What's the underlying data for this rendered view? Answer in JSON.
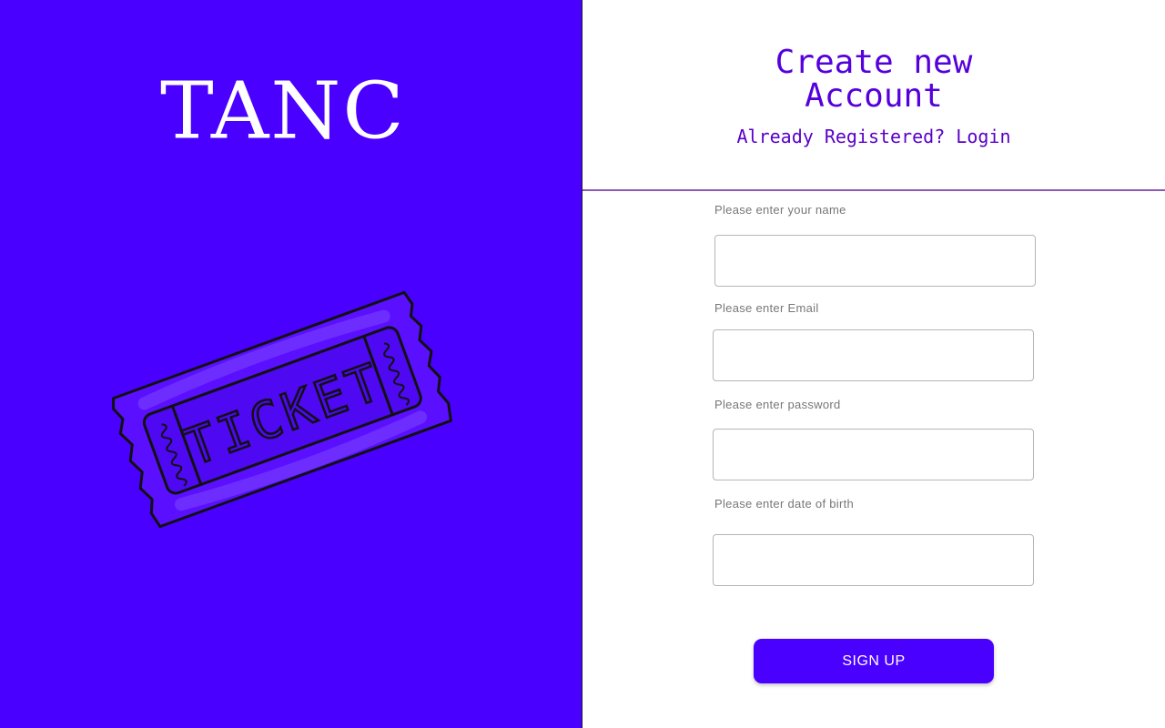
{
  "brand": {
    "name": "TANC"
  },
  "illustration": {
    "text": "TICKET",
    "icon": "ticket-icon"
  },
  "header": {
    "title": "Create new\nAccount",
    "login_link": "Already Registered? Login"
  },
  "form": {
    "name_label": "Please enter your name",
    "name_value": "",
    "email_label": "Please enter Email",
    "email_value": "",
    "password_label": "Please enter password",
    "password_value": "",
    "dob_label": "Please enter date of birth",
    "dob_value": "",
    "submit_label": "SIGN UP"
  },
  "colors": {
    "brand": "#4a00ff",
    "accent_text": "#5500dd",
    "divider": "#8a5bb8"
  }
}
